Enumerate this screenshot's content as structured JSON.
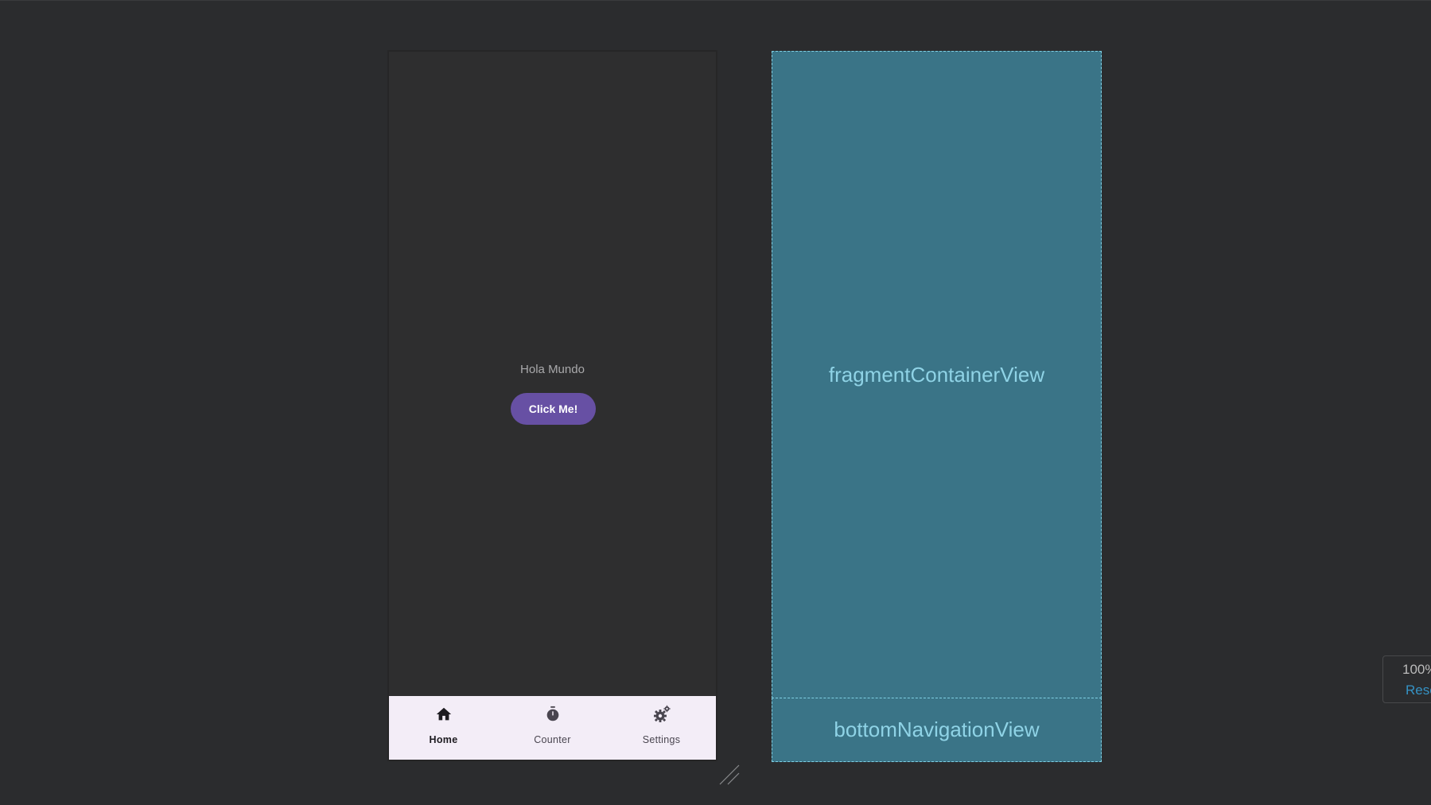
{
  "design_preview": {
    "hello_text": "Hola Mundo",
    "button_label": "Click Me!",
    "bottom_nav": {
      "items": [
        {
          "label": "Home",
          "icon": "home-icon",
          "active": true
        },
        {
          "label": "Counter",
          "icon": "timer-icon",
          "active": false
        },
        {
          "label": "Settings",
          "icon": "settings-icon",
          "active": false
        }
      ]
    }
  },
  "blueprint": {
    "fragment_label": "fragmentContainerView",
    "bottom_nav_label": "bottomNavigationView"
  },
  "zoom": {
    "value": "100%",
    "reset_label": "Reset"
  },
  "colors": {
    "background": "#2b2c2e",
    "phone_bg": "#2e2e2f",
    "button": "#6750a4",
    "nav_bg": "#f3edf7",
    "blueprint_fill": "#3a7487",
    "blueprint_border": "#7fd0e4",
    "link": "#3592c4"
  }
}
